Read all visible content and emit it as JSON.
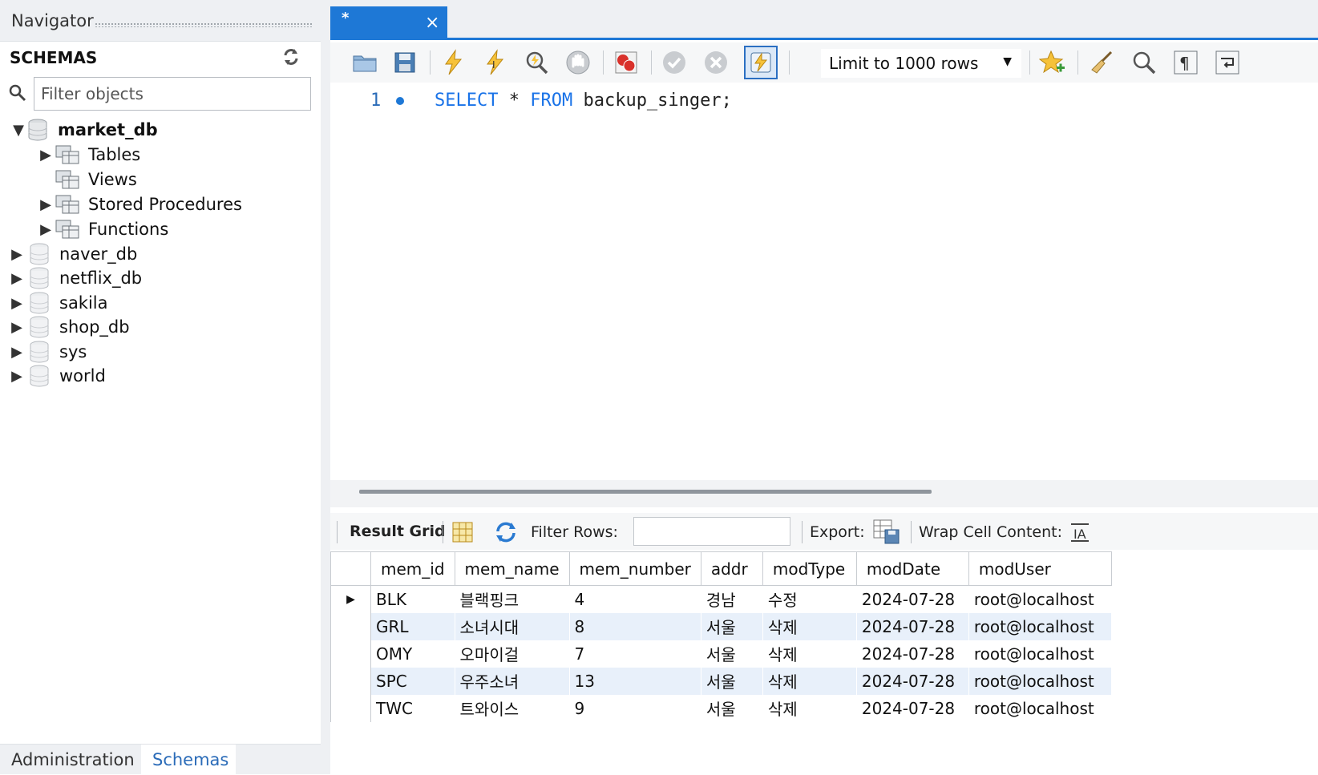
{
  "navigator": {
    "title": "Navigator",
    "schemas_label": "SCHEMAS",
    "filter_placeholder": "Filter objects",
    "tree": [
      {
        "label": "market_db",
        "expanded": true,
        "bold": true
      },
      {
        "label": "Tables"
      },
      {
        "label": "Views"
      },
      {
        "label": "Stored Procedures"
      },
      {
        "label": "Functions"
      },
      {
        "label": "naver_db"
      },
      {
        "label": "netflix_db"
      },
      {
        "label": "sakila"
      },
      {
        "label": "shop_db"
      },
      {
        "label": "sys"
      },
      {
        "label": "world"
      }
    ],
    "bottom_tabs": {
      "administration": "Administration",
      "schemas": "Schemas"
    }
  },
  "editor": {
    "tab_title": "*",
    "tab_close": "×",
    "limit_label": "Limit to 1000 rows",
    "line_number": "1",
    "sql": {
      "kw1": "SELECT",
      "star": " * ",
      "kw2": "FROM",
      "rest": " backup_singer;"
    },
    "accent_color": "#1e78d6"
  },
  "result": {
    "result_grid_label": "Result Grid",
    "filter_rows_label": "Filter Rows:",
    "export_label": "Export:",
    "wrap_label": "Wrap Cell Content:",
    "columns": [
      "mem_id",
      "mem_name",
      "mem_number",
      "addr",
      "modType",
      "modDate",
      "modUser"
    ],
    "rows": [
      [
        "BLK",
        "블랙핑크",
        "4",
        "경남",
        "수정",
        "2024-07-28",
        "root@localhost"
      ],
      [
        "GRL",
        "소녀시대",
        "8",
        "서울",
        "삭제",
        "2024-07-28",
        "root@localhost"
      ],
      [
        "OMY",
        "오마이걸",
        "7",
        "서울",
        "삭제",
        "2024-07-28",
        "root@localhost"
      ],
      [
        "SPC",
        "우주소녀",
        "13",
        "서울",
        "삭제",
        "2024-07-28",
        "root@localhost"
      ],
      [
        "TWC",
        "트와이스",
        "9",
        "서울",
        "삭제",
        "2024-07-28",
        "root@localhost"
      ]
    ],
    "current_row_marker": "▶"
  }
}
